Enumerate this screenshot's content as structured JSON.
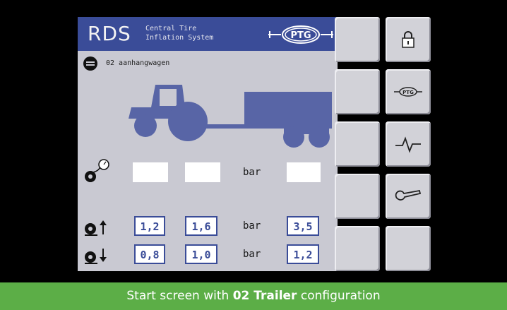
{
  "header": {
    "brand": "RDS",
    "subtitle_line1": "Central Tire",
    "subtitle_line2": "Inflation System",
    "logo_text": "PTG"
  },
  "configuration": {
    "name": "02 aanhangwagen"
  },
  "current_pressure": {
    "values": [
      "",
      "",
      ""
    ],
    "unit": "bar"
  },
  "upper_limit": {
    "values": [
      "1,2",
      "1,6",
      "3,5"
    ],
    "unit": "bar"
  },
  "lower_limit": {
    "values": [
      "0,8",
      "1,0",
      "1,2"
    ],
    "unit": "bar"
  },
  "softkeys": [
    {
      "name": "softkey-1",
      "icon": ""
    },
    {
      "name": "softkey-lock",
      "icon": "lock-icon"
    },
    {
      "name": "softkey-3",
      "icon": ""
    },
    {
      "name": "softkey-ptg",
      "icon": "ptg-logo-icon"
    },
    {
      "name": "softkey-5",
      "icon": ""
    },
    {
      "name": "softkey-pulse",
      "icon": "pulse-icon"
    },
    {
      "name": "softkey-7",
      "icon": ""
    },
    {
      "name": "softkey-wrench",
      "icon": "wrench-icon"
    },
    {
      "name": "softkey-9",
      "icon": ""
    },
    {
      "name": "softkey-10",
      "icon": ""
    }
  ],
  "caption": {
    "prefix": "Start screen with ",
    "bold": "02 Trailer",
    "suffix": " configuration"
  },
  "colors": {
    "header_blue": "#3a4c98",
    "panel_grey": "#c9c9d2",
    "vehicle_blue": "#5865a6",
    "caption_green": "#5cae47"
  }
}
